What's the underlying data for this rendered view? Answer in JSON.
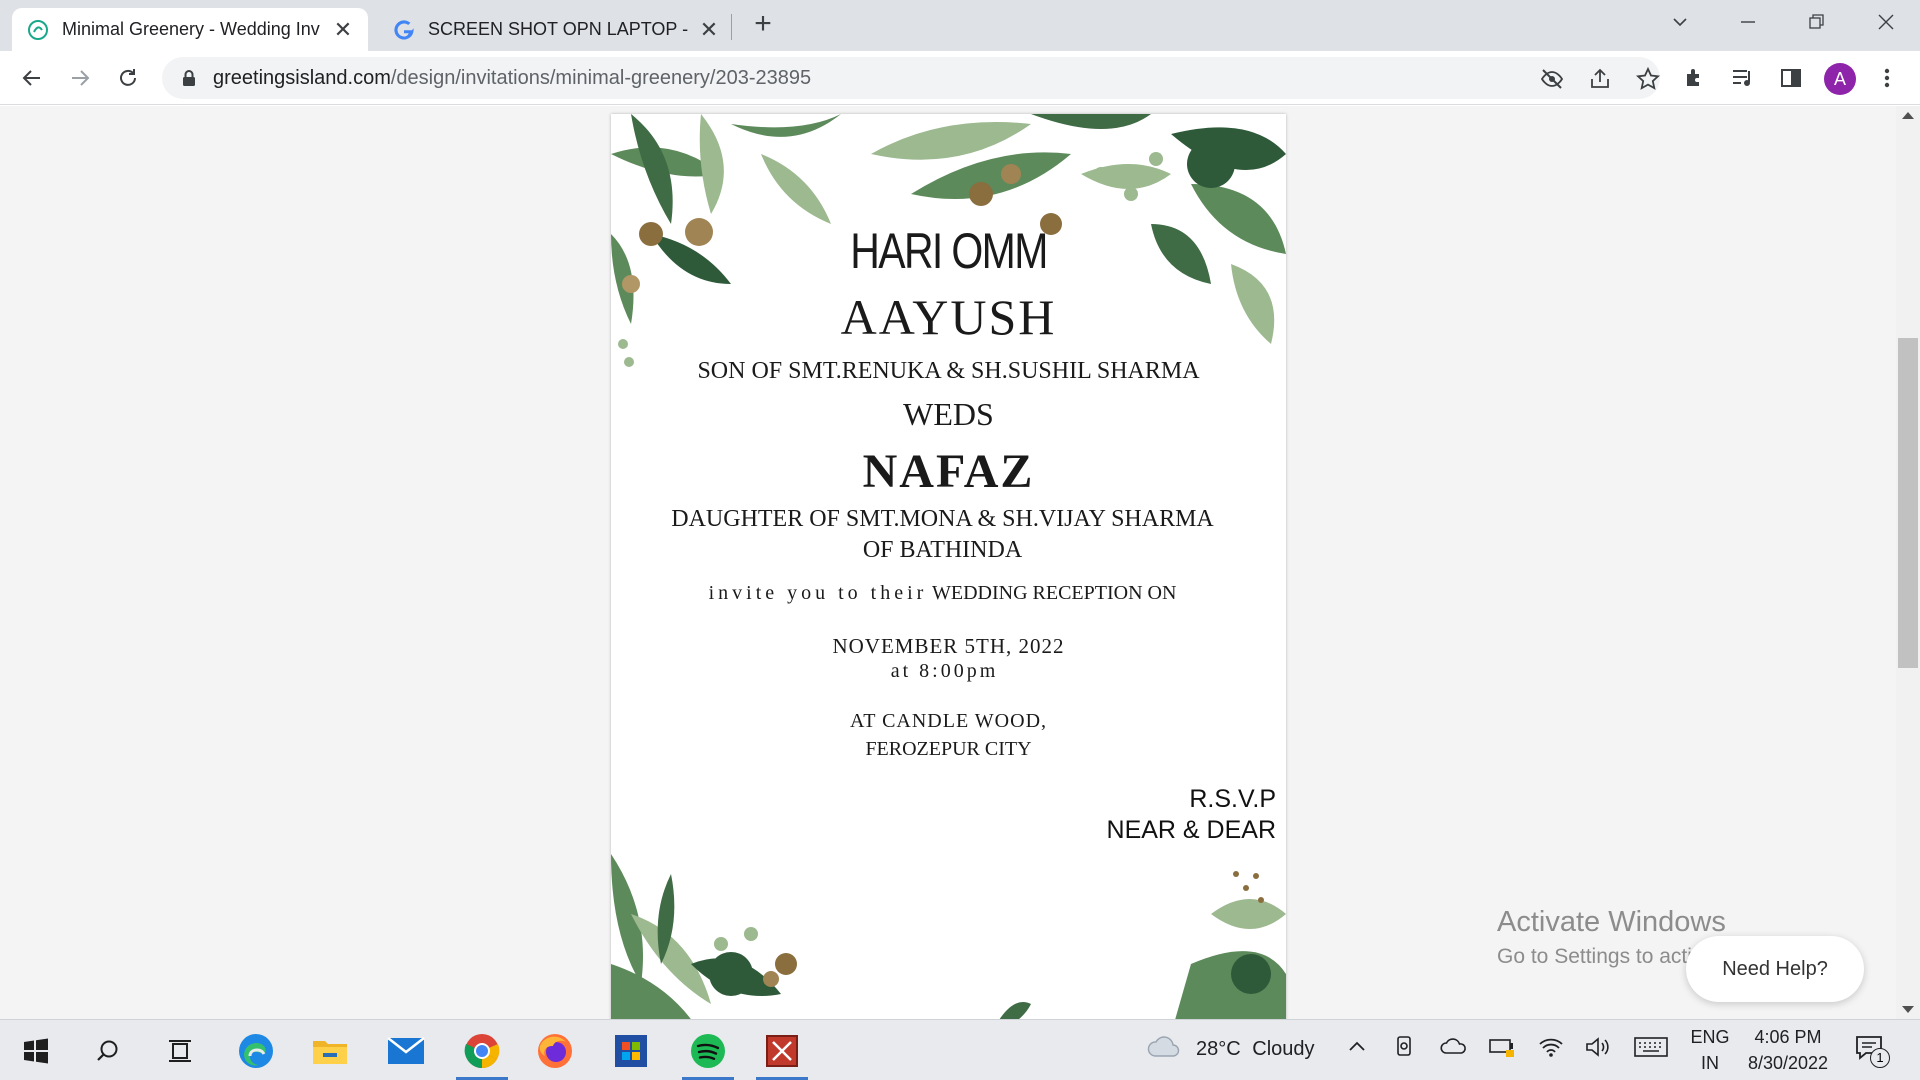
{
  "browser": {
    "tabs": [
      {
        "title": "Minimal Greenery - Wedding Inv",
        "favicon": "greetings-island-icon",
        "active": true
      },
      {
        "title": "SCREEN SHOT OPN LAPTOP - Go",
        "favicon": "google-icon",
        "active": false
      }
    ],
    "url_host": "greetingsisland.com",
    "url_path": "/design/invitations/minimal-greenery/203-23895",
    "profile_initial": "A"
  },
  "invitation": {
    "line1": "HARI OMM",
    "groom": "AAYUSH",
    "groom_parents": "SON OF SMT.RENUKA & SH.SUSHIL SHARMA",
    "weds": "WEDS",
    "bride": "NAFAZ",
    "bride_parents": "DAUGHTER OF SMT.MONA & SH.VIJAY SHARMA",
    "bride_place": "OF BATHINDA",
    "invite_lead": "invite you to their",
    "invite_event": "WEDDING RECEPTION ON",
    "date": "NOVEMBER 5TH, 2022",
    "time": "at 8:00pm",
    "venue1": "AT CANDLE WOOD,",
    "venue2": "FEROZEPUR CITY",
    "rsvp": "R.S.V.P",
    "rsvp_name": "NEAR & DEAR"
  },
  "overlay": {
    "activate_title": "Activate Windows",
    "activate_sub": "Go to Settings to activate Windows.",
    "help": "Need Help?"
  },
  "taskbar": {
    "weather_temp": "28°C",
    "weather_text": "Cloudy",
    "lang1": "ENG",
    "lang2": "IN",
    "time": "4:06 PM",
    "date": "8/30/2022",
    "notifications": "1"
  },
  "colors": {
    "leaf_dark": "#2f5a3a",
    "leaf_mid": "#5d8a5b",
    "leaf_light": "#9cb98f",
    "bud": "#8a6e3e",
    "accent_blue": "#3b78c9"
  }
}
